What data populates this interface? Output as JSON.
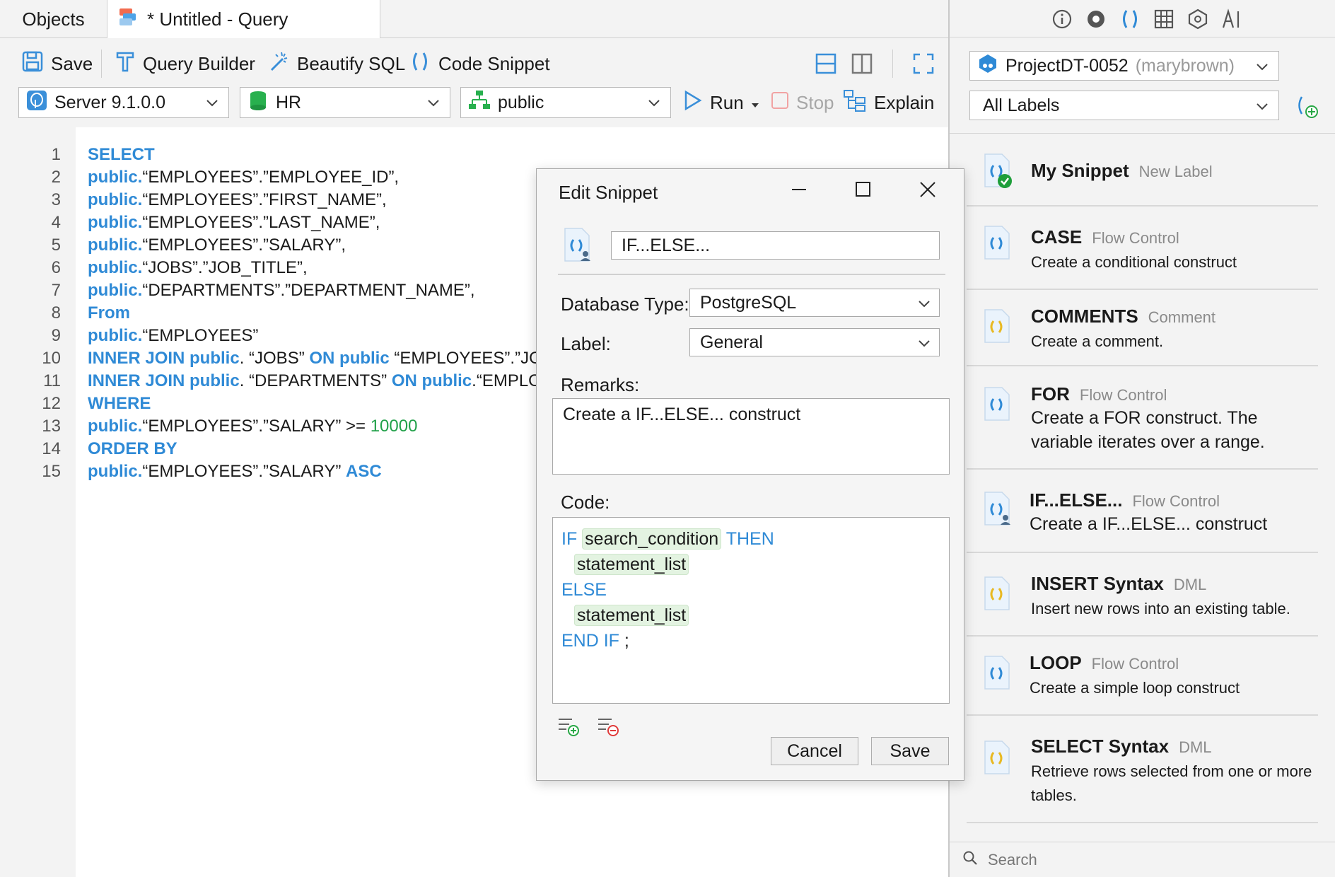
{
  "tabs": {
    "objects": "Objects",
    "query": "* Untitled - Query"
  },
  "toolbar": {
    "save": "Save",
    "query_builder": "Query Builder",
    "beautify": "Beautify SQL",
    "code_snippet": "Code Snippet",
    "server": "Server 9.1.0.0",
    "database": "HR",
    "schema": "public",
    "run": "Run",
    "stop": "Stop",
    "explain": "Explain"
  },
  "editor": {
    "lines": [
      {
        "n": "1"
      },
      {
        "n": "2"
      },
      {
        "n": "3"
      },
      {
        "n": "4"
      },
      {
        "n": "5"
      },
      {
        "n": "6"
      },
      {
        "n": "7"
      },
      {
        "n": "8"
      },
      {
        "n": "9"
      },
      {
        "n": "10"
      },
      {
        "n": "11"
      },
      {
        "n": "12"
      },
      {
        "n": "13"
      },
      {
        "n": "14"
      },
      {
        "n": "15"
      }
    ],
    "code": {
      "select": "SELECT",
      "public": "public.",
      "l2": "“EMPLOYEES”.”EMPLOYEE_ID”,",
      "l3": "“EMPLOYEES”.”FIRST_NAME”,",
      "l4": "“EMPLOYEES”.”LAST_NAME”,",
      "l5": "“EMPLOYEES”.”SALARY”,",
      "l6": "“JOBS”.”JOB_TITLE”,",
      "l7": "“DEPARTMENTS”.”DEPARTMENT_NAME”,",
      "from": "From",
      "l9": "“EMPLOYEES”",
      "inner_join_public": "INNER JOIN public",
      "l10a": ". “JOBS” ",
      "on_public": "ON public",
      "l10b": " “EMPLOYEES”.”JOB",
      "l11a": ". “DEPARTMENTS” ",
      "l11b": ".“EMPLOY",
      "where": "WHERE",
      "l13": "“EMPLOYEES”.”SALARY” >= ",
      "l13num": "10000",
      "order_by": "ORDER BY",
      "l15": "“EMPLOYEES”.”SALARY” ",
      "asc": "ASC"
    }
  },
  "dialog": {
    "title": "Edit Snippet",
    "name": "IF...ELSE...",
    "db_type_label": "Database Type:",
    "db_type": "PostgreSQL",
    "label_label": "Label:",
    "label": "General",
    "remarks_label": "Remarks:",
    "remarks": "Create a IF...ELSE... construct",
    "code_label": "Code:",
    "code": {
      "if": "IF",
      "search_condition": "search_condition",
      "then": "THEN",
      "statement_list": "statement_list",
      "else": "ELSE",
      "end_if": "END IF",
      "semicolon": ";"
    },
    "cancel": "Cancel",
    "save": "Save"
  },
  "right_panel": {
    "project": "ProjectDT-0052",
    "project_user": "(marybrown)",
    "labels_filter": "All Labels",
    "snippets": [
      {
        "title": "My Snippet",
        "label": "New Label",
        "desc": ""
      },
      {
        "title": "CASE",
        "label": "Flow Control",
        "desc": "Create a conditional construct"
      },
      {
        "title": "COMMENTS",
        "label": "Comment",
        "desc": "Create a comment."
      },
      {
        "title": "FOR",
        "label": "Flow Control",
        "desc": "Create a FOR construct. The variable iterates over a range."
      },
      {
        "title": "IF...ELSE...",
        "label": "Flow Control",
        "desc": "Create a IF...ELSE... construct"
      },
      {
        "title": "INSERT Syntax",
        "label": "DML",
        "desc": "Insert new rows into an existing table."
      },
      {
        "title": "LOOP",
        "label": "Flow Control",
        "desc": "Create a simple loop construct"
      },
      {
        "title": "SELECT Syntax",
        "label": "DML",
        "desc": "Retrieve rows selected from one or more tables."
      }
    ],
    "search_placeholder": "Search"
  },
  "colors": {
    "keyword": "#2f8ad6",
    "number": "#22a14a",
    "panel_bg": "#f3f3f3",
    "token_bg": "#e3f3e1"
  }
}
